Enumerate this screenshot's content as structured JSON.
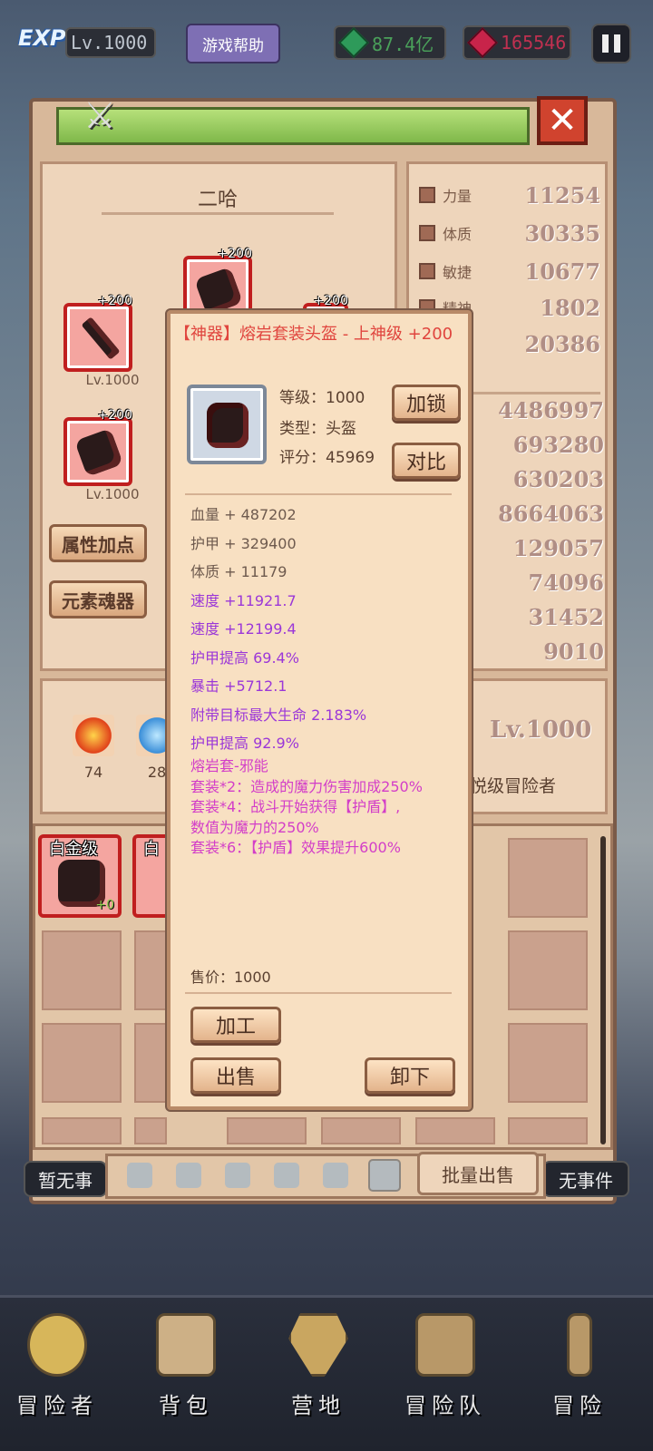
{
  "top_bar": {
    "exp_label": "EXP",
    "level": "Lv.1000",
    "help_button": "游戏帮助",
    "green_currency": "87.4亿",
    "red_currency": "165546"
  },
  "character": {
    "name": "二哈",
    "slots": [
      {
        "plus": "+200",
        "level": "Lv.1000"
      },
      {
        "plus": "+200",
        "level": "Lv.1000"
      },
      {
        "plus": "+200",
        "level": ""
      },
      {
        "plus": "+200",
        "level": ""
      }
    ],
    "buttons": [
      "属性加点",
      "元素魂器"
    ],
    "elements": [
      {
        "count": "74"
      },
      {
        "count": "28"
      }
    ],
    "level_display": "Lv.1000",
    "rank": "悦级冒险者"
  },
  "stats": {
    "primary": [
      {
        "label": "力量",
        "value": "11254"
      },
      {
        "label": "体质",
        "value": "30335"
      },
      {
        "label": "敏捷",
        "value": "10677"
      },
      {
        "label": "精神",
        "value": "1802"
      },
      {
        "label": "",
        "value": "20386"
      }
    ],
    "secondary": [
      "4486997",
      "693280",
      "630203",
      "8664063",
      "129057",
      "74096",
      "31452",
      "9010"
    ]
  },
  "inventory": {
    "items": [
      {
        "tag": "白金级",
        "plus": "+0"
      },
      {
        "tag": "白",
        "plus": ""
      }
    ],
    "left_status": "暂无事",
    "right_status": "无事件",
    "batch_sell": "批量出售"
  },
  "popup": {
    "title": "【神器】熔岩套装头盔 - 上神级 +200",
    "level_line": "等级：1000",
    "type_line": "类型：头盔",
    "score_line": "评分：45969",
    "lock_button": "加锁",
    "compare_button": "对比",
    "attributes": [
      {
        "text": "血量 + 487202",
        "color": "#6e5a4e"
      },
      {
        "text": "护甲 + 329400",
        "color": "#6e5a4e"
      },
      {
        "text": "体质 + 11179",
        "color": "#6e5a4e"
      },
      {
        "text": "速度 +11921.7",
        "color": "#9b37d8"
      },
      {
        "text": "速度 +12199.4",
        "color": "#9b37d8"
      },
      {
        "text": "护甲提高 69.4%",
        "color": "#9b37d8"
      },
      {
        "text": "暴击 +5712.1",
        "color": "#9b37d8"
      },
      {
        "text": "附带目标最大生命 2.183%",
        "color": "#9b37d8"
      },
      {
        "text": "护甲提高 92.9%",
        "color": "#9b37d8"
      }
    ],
    "set_lines": [
      "熔岩套-邪能",
      "套装*2：造成的魔力伤害加成250%",
      "套装*4：战斗开始获得【护盾】,",
      "数值为魔力的250%",
      "套装*6：【护盾】效果提升600%"
    ],
    "set_color": "#d33ec8",
    "price": "售价：1000",
    "process_button": "加工",
    "sell_button": "出售",
    "unequip_button": "卸下"
  },
  "nav": [
    "冒险者",
    "背包",
    "营地",
    "冒险队",
    "冒险"
  ]
}
